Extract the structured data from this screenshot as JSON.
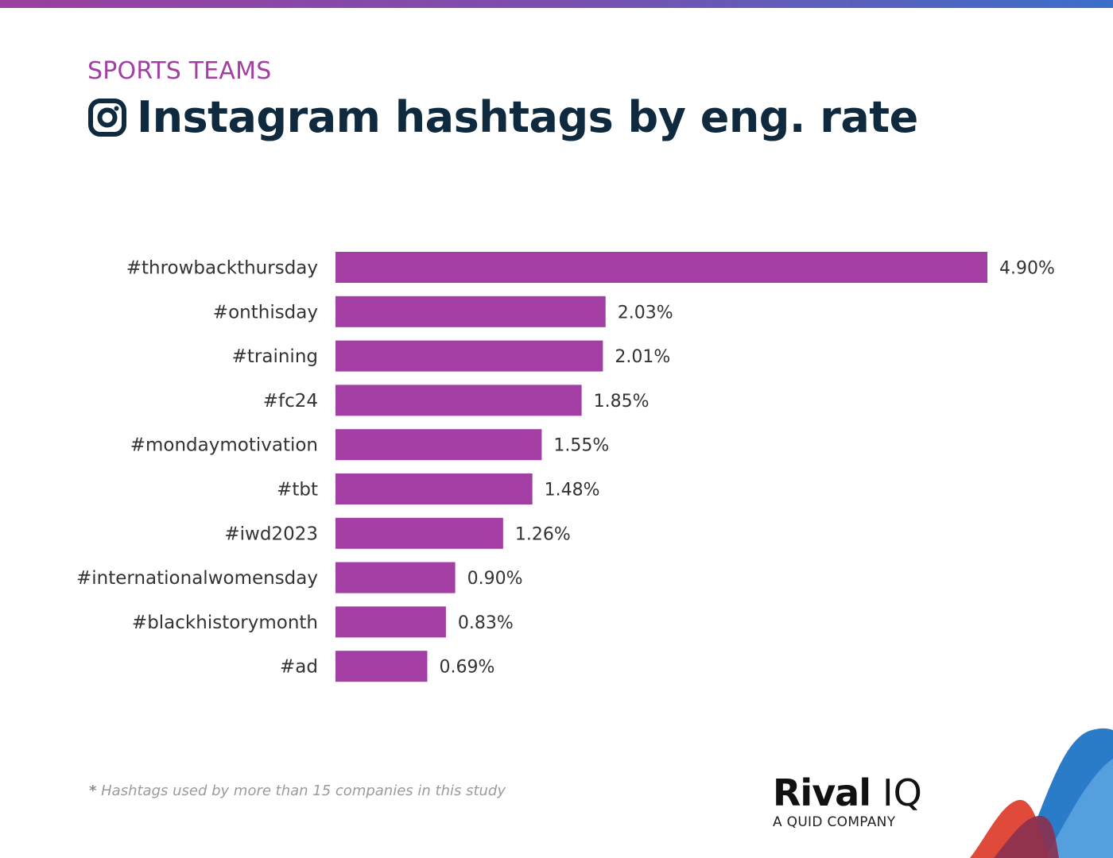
{
  "header": {
    "eyebrow": "SPORTS TEAMS",
    "title": "Instagram hashtags by eng. rate",
    "icon": "instagram-icon"
  },
  "footnote": {
    "asterisk": "*",
    "text": " Hashtags used by more than 15 companies in this study"
  },
  "logo": {
    "brand_a": "Rival",
    "brand_b": "IQ",
    "tagline": "A QUID COMPANY"
  },
  "colors": {
    "bar": "#a33fa4",
    "title": "#0f2a3e",
    "eyebrow": "#a33fa4",
    "label": "#333333"
  },
  "chart_data": {
    "type": "bar",
    "orientation": "horizontal",
    "title": "Instagram hashtags by eng. rate",
    "xlabel": "",
    "ylabel": "",
    "categories": [
      "#throwbackthursday",
      "#onthisday",
      "#training",
      "#fc24",
      "#mondaymotivation",
      "#tbt",
      "#iwd2023",
      "#internationalwomensday",
      "#blackhistorymonth",
      "#ad"
    ],
    "values": [
      4.9,
      2.03,
      2.01,
      1.85,
      1.55,
      1.48,
      1.26,
      0.9,
      0.83,
      0.69
    ],
    "value_labels": [
      "4.90%",
      "2.03%",
      "2.01%",
      "1.85%",
      "1.55%",
      "1.48%",
      "1.26%",
      "0.90%",
      "0.83%",
      "0.69%"
    ],
    "unit": "%",
    "xlim": [
      0,
      4.9
    ],
    "grid": false,
    "legend": "none"
  }
}
